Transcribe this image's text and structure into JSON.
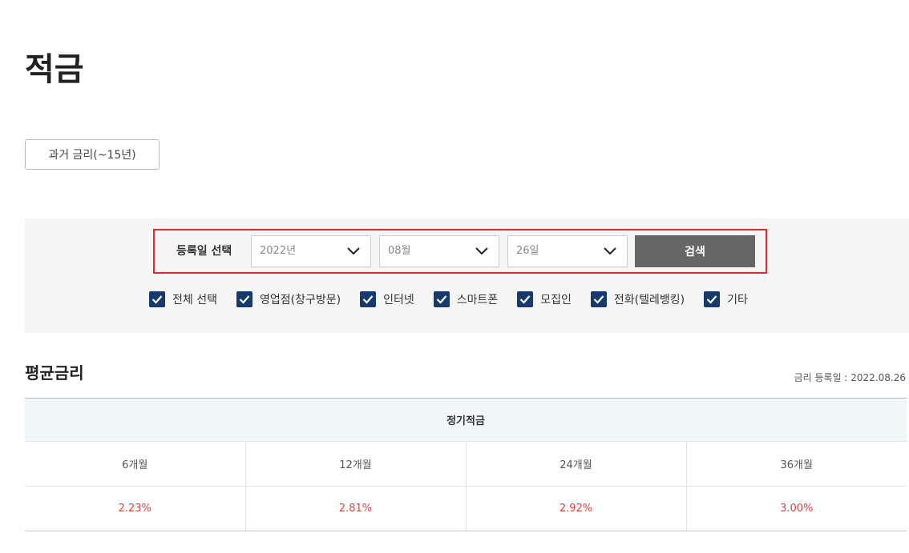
{
  "page": {
    "title": "적금"
  },
  "history_button": {
    "label": "과거 금리(~15년)"
  },
  "search": {
    "label": "등록일 선택",
    "year": "2022년",
    "month": "08월",
    "day": "26일",
    "button_label": "검색"
  },
  "channels": [
    {
      "label": "전체 선택",
      "checked": true
    },
    {
      "label": "영업점(창구방문)",
      "checked": true
    },
    {
      "label": "인터넷",
      "checked": true
    },
    {
      "label": "스마트폰",
      "checked": true
    },
    {
      "label": "모집인",
      "checked": true
    },
    {
      "label": "전화(텔레뱅킹)",
      "checked": true
    },
    {
      "label": "기타",
      "checked": true
    }
  ],
  "average_rate": {
    "title": "평균금리",
    "date_text": "금리 등록일 : 2022.08.26",
    "product": "정기적금",
    "terms": [
      "6개월",
      "12개월",
      "24개월",
      "36개월"
    ],
    "rates": [
      "2.23%",
      "2.81%",
      "2.92%",
      "3.00%"
    ]
  },
  "colors": {
    "highlight_border": "#e02a2a",
    "checkbox": "#163a6e",
    "rate_value": "#e0413c",
    "search_button": "#666666"
  }
}
